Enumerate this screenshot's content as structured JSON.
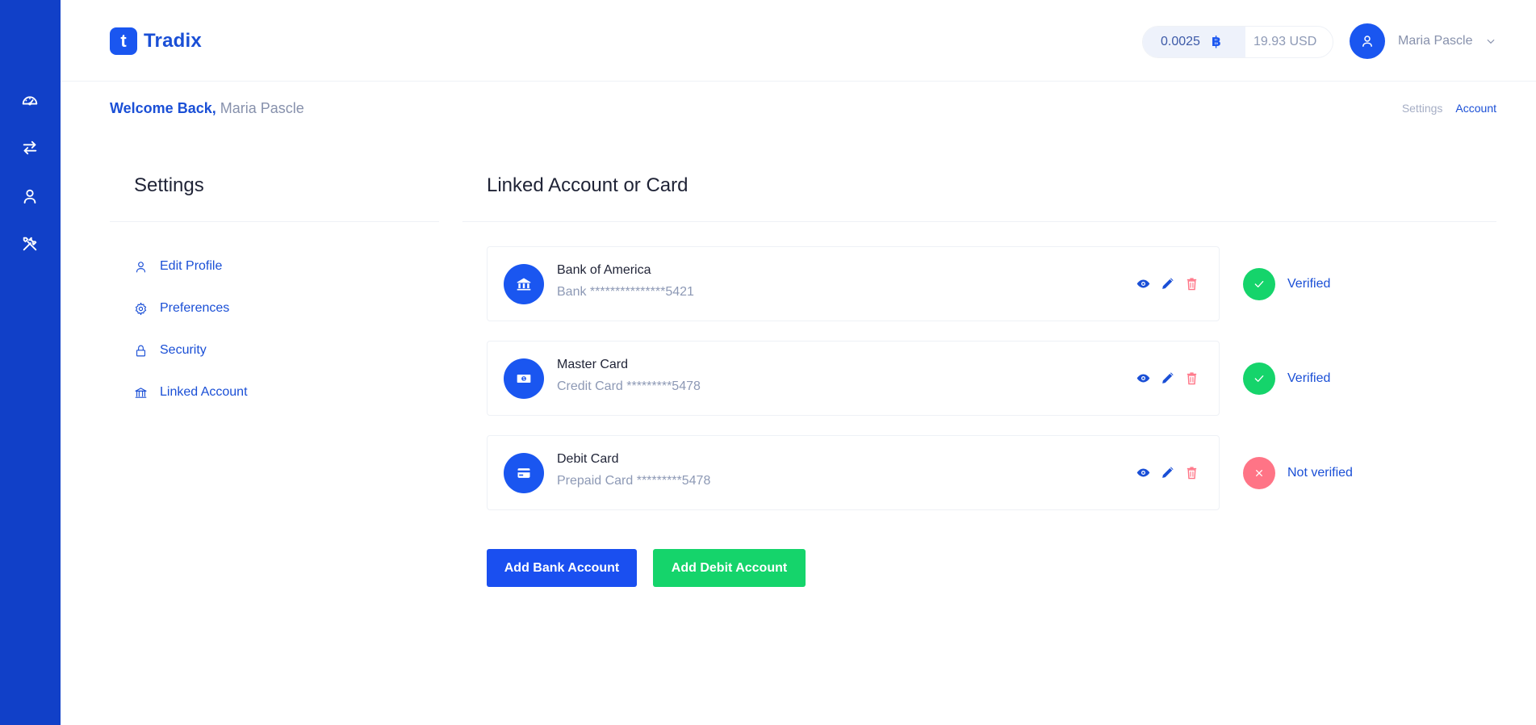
{
  "brand": {
    "logo_letter": "t",
    "name": "Tradix",
    "accent": "#1a56f0",
    "sidebar_bg": "#1140c8"
  },
  "sidebar": {
    "items": [
      {
        "icon": "dashboard-icon"
      },
      {
        "icon": "exchange-arrows-icon"
      },
      {
        "icon": "user-icon"
      },
      {
        "icon": "tools-icon"
      }
    ]
  },
  "header": {
    "balance_btc": "0.0025",
    "btc_symbol": "฿",
    "balance_usd": "19.93 USD",
    "user_name": "Maria Pascle"
  },
  "welcome": {
    "greeting": "Welcome Back,",
    "name": "Maria Pascle"
  },
  "breadcrumb": {
    "items": [
      "Settings",
      "Account"
    ]
  },
  "settings": {
    "title": "Settings",
    "menu": [
      {
        "label": "Edit Profile",
        "icon": "user-icon"
      },
      {
        "label": "Preferences",
        "icon": "gear-icon"
      },
      {
        "label": "Security",
        "icon": "lock-icon"
      },
      {
        "label": "Linked Account",
        "icon": "bank-icon"
      }
    ]
  },
  "linked": {
    "title": "Linked Account or Card",
    "accounts": [
      {
        "name": "Bank of America",
        "number": "Bank ***************5421",
        "icon": "bank-icon",
        "status": "Verified",
        "status_color": "#15d46b"
      },
      {
        "name": "Master Card",
        "number": "Credit Card *********5478",
        "icon": "money-icon",
        "status": "Verified",
        "status_color": "#15d46b"
      },
      {
        "name": "Debit Card",
        "number": "Prepaid Card *********5478",
        "icon": "credit-card-icon",
        "status": "Not verified",
        "status_color": "#ff7486"
      }
    ],
    "add_bank_label": "Add Bank Account",
    "add_debit_label": "Add Debit Account"
  }
}
